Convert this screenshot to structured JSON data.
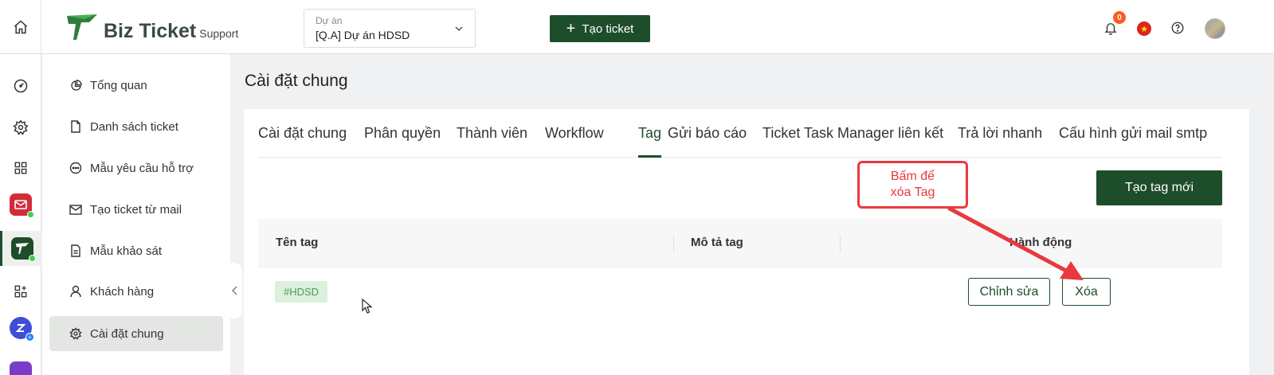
{
  "header": {
    "logo_text": "Biz Ticket",
    "logo_sub": "Support",
    "project": {
      "label": "Dự án",
      "value": "[Q.A] Dự án HDSD"
    },
    "create_ticket_label": "Tạo ticket",
    "notification_count": "0",
    "icons": [
      "home-icon",
      "bell-icon",
      "vn-flag-icon",
      "help-icon",
      "avatar"
    ]
  },
  "rail": {
    "items": [
      "dashboard-icon",
      "settings-icon",
      "apps-grid-icon",
      "mail-app-icon",
      "biz-ticket-app-icon",
      "app-add-icon",
      "chat-app-icon"
    ]
  },
  "sidebar": {
    "items": [
      {
        "label": "Tổng quan",
        "icon": "pie-chart-icon"
      },
      {
        "label": "Danh sách ticket",
        "icon": "file-icon"
      },
      {
        "label": "Mẫu yêu cầu hỗ trợ",
        "icon": "chat-bubble-icon"
      },
      {
        "label": "Tạo ticket từ mail",
        "icon": "mail-icon"
      },
      {
        "label": "Mẫu khảo sát",
        "icon": "document-icon"
      },
      {
        "label": "Khách hàng",
        "icon": "user-icon"
      },
      {
        "label": "Cài đặt chung",
        "icon": "gear-icon",
        "active": true
      }
    ]
  },
  "page": {
    "title": "Cài đặt chung"
  },
  "tabs": [
    {
      "label": "Cài đặt chung"
    },
    {
      "label": "Phân quyền"
    },
    {
      "label": "Thành viên"
    },
    {
      "label": "Workflow"
    },
    {
      "label": "Tag",
      "active": true
    },
    {
      "label": "Gửi báo cáo"
    },
    {
      "label": "Ticket Task Manager liên kết"
    },
    {
      "label": "Trả lời nhanh"
    },
    {
      "label": "Cấu hình gửi mail smtp"
    }
  ],
  "new_tag_label": "Tạo tag mới",
  "table": {
    "columns": [
      "Tên tag",
      "Mô tả tag",
      "Hành động"
    ],
    "rows": [
      {
        "name": "#HDSD",
        "description": "",
        "edit_label": "Chỉnh sửa",
        "delete_label": "Xóa"
      }
    ]
  },
  "annotation": {
    "line1": "Bấm để",
    "line2": "xóa Tag",
    "color": "#e8393f"
  },
  "colors": {
    "brand": "#1e4d2b",
    "tag_bg": "#dcf0dc",
    "tag_text": "#4a9a55",
    "badge": "#ff5a1f"
  }
}
